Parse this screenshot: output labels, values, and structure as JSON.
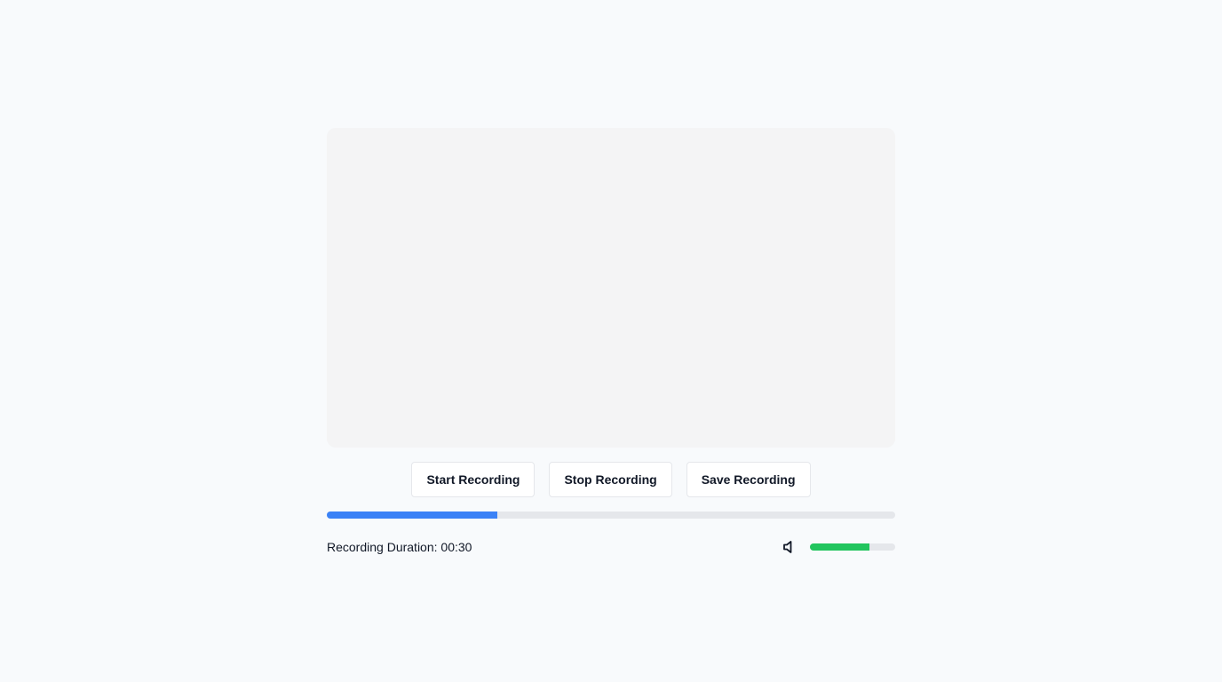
{
  "controls": {
    "start_label": "Start Recording",
    "stop_label": "Stop Recording",
    "save_label": "Save Recording"
  },
  "progress": {
    "percent": 30,
    "color": "#3b82f6"
  },
  "status": {
    "duration_label": "Recording Duration:",
    "duration_value": "00:30"
  },
  "volume": {
    "icon": "speaker-icon",
    "percent": 70,
    "color": "#22c55e"
  }
}
